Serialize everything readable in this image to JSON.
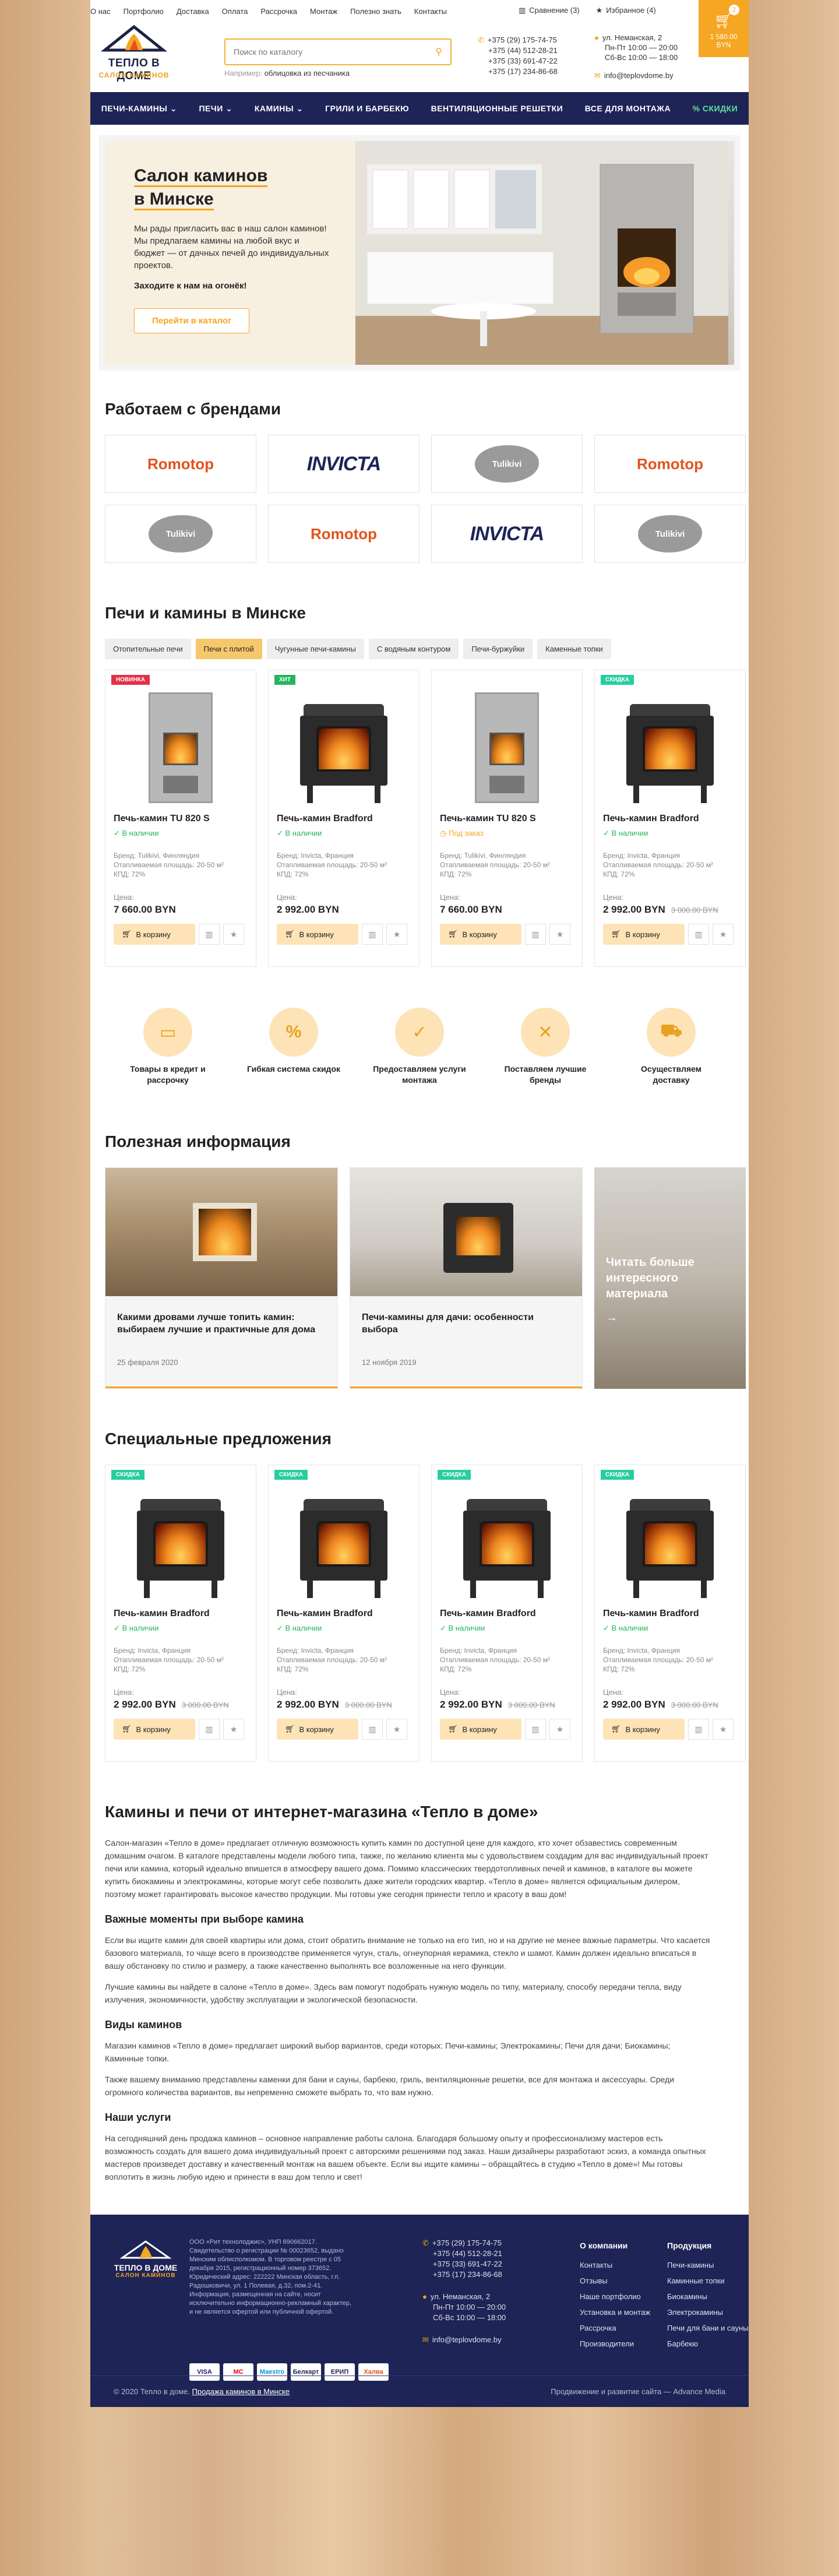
{
  "topnav": [
    "О нас",
    "Портфолио",
    "Доставка",
    "Оплата",
    "Рассрочка",
    "Монтаж",
    "Полезно знать",
    "Контакты"
  ],
  "compare": "Сравнение (3)",
  "favorites": "Избранное (4)",
  "logo": {
    "title": "ТЕПЛО В ДОМЕ",
    "subtitle": "САЛОН КАМИНОВ"
  },
  "search": {
    "placeholder": "Поиск по каталогу",
    "hint_prefix": "Например:",
    "hint_value": "облицовка из песчаника"
  },
  "phones": [
    "+375 (29) 175-74-75",
    "+375 (44) 512-28-21",
    "+375 (33) 691-47-22",
    "+375 (17) 234-86-68"
  ],
  "address": {
    "line1": "ул. Неманская, 2",
    "line2": "Пн-Пт 10:00 — 20:00",
    "line3": "Сб-Вс 10:00 — 18:00"
  },
  "email": "info@teplovdome.by",
  "cart": {
    "count": "2",
    "price": "1 580.00",
    "currency": "BYN"
  },
  "mainnav": [
    "ПЕЧИ-КАМИНЫ ⌄",
    "ПЕЧИ ⌄",
    "КАМИНЫ ⌄",
    "ГРИЛИ И БАРБЕКЮ",
    "ВЕНТИЛЯЦИОННЫЕ РЕШЕТКИ",
    "ВСЕ ДЛЯ МОНТАЖА",
    "% СКИДКИ"
  ],
  "hero": {
    "title1": "Салон каминов",
    "title2": "в Минске",
    "text": "Мы рады пригласить вас в наш салон каминов! Мы предлагаем камины на любой вкус и бюджет — от дачных печей до индивидуальных проектов.",
    "cta": "Заходите к нам на огонёк!",
    "button": "Перейти в каталог"
  },
  "brands_title": "Работаем с брендами",
  "brands": [
    "Romotop",
    "INVICTA",
    "Tulikivi",
    "Romotop",
    "Tulikivi",
    "Romotop",
    "INVICTA",
    "Tulikivi"
  ],
  "products_title": "Печи и камины в Минске",
  "tabs": [
    "Отопительные печи",
    "Печи с плитой",
    "Чугунные печи-камины",
    "С водяным контуром",
    "Печи-буржуйки",
    "Каменные топки"
  ],
  "products": [
    {
      "badge": "НОВИНКА",
      "name": "Печь-камин TU 820 S",
      "avail": "В наличии",
      "brand": "Бренд: Tulikivi, Финляндия",
      "area": "Отапливаемая площадь: 20-50 м²",
      "kpd": "КПД: 72%",
      "price_label": "Цена:",
      "price": "7 660.00 BYN",
      "old": "",
      "buy": "В корзину"
    },
    {
      "badge": "ХИТ",
      "name": "Печь-камин Bradford",
      "avail": "В наличии",
      "brand": "Бренд: Invicta, Франция",
      "area": "Отапливаемая площадь: 20-50 м²",
      "kpd": "КПД: 72%",
      "price_label": "Цена:",
      "price": "2 992.00 BYN",
      "old": "",
      "buy": "В корзину"
    },
    {
      "badge": "",
      "name": "Печь-камин TU 820 S",
      "avail": "Под заказ",
      "brand": "Бренд: Tulikivi, Финляндия",
      "area": "Отапливаемая площадь: 20-50 м²",
      "kpd": "КПД: 72%",
      "price_label": "Цена:",
      "price": "7 660.00 BYN",
      "old": "",
      "buy": "В корзину"
    },
    {
      "badge": "СКИДКА",
      "name": "Печь-камин Bradford",
      "avail": "В наличии",
      "brand": "Бренд: Invicta, Франция",
      "area": "Отапливаемая площадь: 20-50 м²",
      "kpd": "КПД: 72%",
      "price_label": "Цена:",
      "price": "2 992.00 BYN",
      "old": "3 000.00 BYN",
      "buy": "В корзину"
    }
  ],
  "features": [
    "Товары в кредит и рассрочку",
    "Гибкая система скидок",
    "Предоставляем услуги монтажа",
    "Поставляем лучшие бренды",
    "Осуществляем доставку"
  ],
  "articles_title": "Полезная информация",
  "articles": [
    {
      "title": "Какими дровами лучше топить камин: выбираем лучшие и практичные для дома",
      "date": "25 февраля 2020"
    },
    {
      "title": "Печи-камины для дачи: особенности выбора",
      "date": "12 ноября 2019"
    }
  ],
  "articles_more": "Читать больше интересного материала",
  "special_title": "Специальные предложения",
  "special": [
    {
      "badge": "СКИДКА",
      "name": "Печь-камин Bradford",
      "avail": "В наличии",
      "brand": "Бренд: Invicta, Франция",
      "area": "Отапливаемая площадь: 20-50 м²",
      "kpd": "КПД: 72%",
      "price_label": "Цена:",
      "price": "2 992.00 BYN",
      "old": "3 000.00 BYN",
      "buy": "В корзину"
    },
    {
      "badge": "СКИДКА",
      "name": "Печь-камин Bradford",
      "avail": "В наличии",
      "brand": "Бренд: Invicta, Франция",
      "area": "Отапливаемая площадь: 20-50 м²",
      "kpd": "КПД: 72%",
      "price_label": "Цена:",
      "price": "2 992.00 BYN",
      "old": "3 000.00 BYN",
      "buy": "В корзину"
    },
    {
      "badge": "СКИДКА",
      "name": "Печь-камин Bradford",
      "avail": "В наличии",
      "brand": "Бренд: Invicta, Франция",
      "area": "Отапливаемая площадь: 20-50 м²",
      "kpd": "КПД: 72%",
      "price_label": "Цена:",
      "price": "2 992.00 BYN",
      "old": "3 000.00 BYN",
      "buy": "В корзину"
    },
    {
      "badge": "СКИДКА",
      "name": "Печь-камин Bradford",
      "avail": "В наличии",
      "brand": "Бренд: Invicta, Франция",
      "area": "Отапливаемая площадь: 20-50 м²",
      "kpd": "КПД: 72%",
      "price_label": "Цена:",
      "price": "2 992.00 BYN",
      "old": "3 000.00 BYN",
      "buy": "В корзину"
    }
  ],
  "seo": {
    "title": "Камины и печи от интернет-магазина «Тепло в доме»",
    "p1": "Салон-магазин «Тепло в доме» предлагает отличную возможность купить камин по доступной цене для каждого, кто хочет обзавестись современным домашним очагом. В каталоге представлены модели любого типа, также, по желанию клиента мы с удовольствием создадим для вас индивидуальный проект печи или камина, который идеально впишется в атмосферу вашего дома. Помимо классических твердотопливных печей и каминов, в каталоге вы можете купить биокамины и электрокамины, которые могут себе позволить даже жители городских квартир. «Тепло в доме» является официальным дилером, поэтому может гарантировать высокое качество продукции. Мы готовы уже сегодня принести тепло и красоту в ваш дом!",
    "h1": "Важные моменты при выборе камина",
    "p2": "Если вы ищите камин для своей квартиры или дома, стоит обратить внимание не только на его тип, но и на другие не менее важные параметры. Что касается базового материала, то чаще всего в производстве применяется чугун, сталь, огнеупорная керамика, стекло и шамот. Камин должен идеально вписаться в вашу обстановку по стилю и размеру, а также качественно выполнять все возложенные на него функции.",
    "p3": "Лучшие камины вы найдете в салоне «Тепло в доме». Здесь вам помогут подобрать нужную модель по типу, материалу, способу передачи тепла, виду излучения, экономичности, удобству эксплуатации и экологической безопасности.",
    "h2": "Виды каминов",
    "p4": "Магазин каминов «Тепло в доме» предлагает широкий выбор вариантов, среди которых: Печи-камины; Электрокамины; Печи для дачи; Биокамины; Каминные топки.",
    "p5": "Также вашему вниманию представлены каменки для бани и сауны, барбекю, гриль, вентиляционные решетки, все для монтажа и аксессуары. Среди огромного количества вариантов, вы непременно сможете выбрать то, что вам нужно.",
    "h3": "Наши услуги",
    "p6": "На сегодняшний день продажа каминов – основное направление работы салона. Благодаря большому опыту и профессионализму мастеров есть возможность создать для вашего дома индивидуальный проект с авторскими решениями под заказ. Наши дизайнеры разработают эскиз, а команда опытных мастеров произведет доставку и качественный монтаж на вашем объекте. Если вы ищите камины – обращайтесь в студию «Тепло в доме»! Мы готовы воплотить в жизнь любую идею и принести в ваш дом тепло и свет!"
  },
  "footer": {
    "legal": "ООО «Рит технолоджис», УНП 690662017. Свидетельство о регистрации № 00023652, выдано Минским облисполкомом. В торговом реестре с 05 декабря 2015, регистрационный номер 373652. Юридический адрес: 222222 Минская область, г.п. Радошковичи, ул. 1 Полевая, д.32, пом.2-41. Информация, размещенная на сайте, носит исключительно информационно-рекламный характер, и не является офертой или публичной офертой.",
    "phones": [
      "+375 (29) 175-74-75",
      "+375 (44) 512-28-21",
      "+375 (33) 691-47-22",
      "+375 (17) 234-86-68"
    ],
    "address": [
      "ул. Неманская, 2",
      "Пн-Пт 10:00 — 20:00",
      "Сб-Вс 10:00 — 18:00"
    ],
    "email": "info@teplovdome.by",
    "col1_title": "О компании",
    "col1": [
      "Контакты",
      "Отзывы",
      "Наше портфолио",
      "Установка и монтаж",
      "Рассрочка",
      "Производители"
    ],
    "col2_title": "Продукция",
    "col2": [
      "Печи-камины",
      "Каминные топки",
      "Биокамины",
      "Электрокамины",
      "Печи для бани и сауны",
      "Барбекю"
    ],
    "payments": [
      "VISA",
      "MC",
      "Maestro",
      "Белкарт",
      "ЕРИП",
      "Халва"
    ],
    "copyright": "© 2020 Тепло в доме.",
    "copyright_link": "Продажа каминов в Минске",
    "dev": "Продвижение и развитие сайта — Advance Media"
  }
}
